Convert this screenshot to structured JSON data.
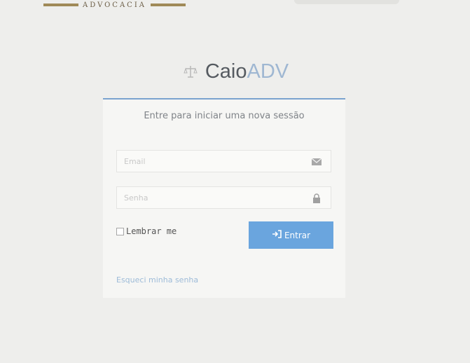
{
  "brand": {
    "tagline": "ADVOCACIA"
  },
  "logo": {
    "name_main": "Caio",
    "name_accent": "ADV",
    "icon": "scales-icon"
  },
  "login": {
    "title": "Entre para iniciar uma nova sessão",
    "email_placeholder": "Email",
    "email_icon": "envelope-icon",
    "password_placeholder": "Senha",
    "password_icon": "lock-icon",
    "remember_label": "Lembrar me",
    "submit_label": "Entrar",
    "submit_icon": "sign-in-icon",
    "forgot_link": "Esqueci minha senha"
  },
  "colors": {
    "accent": "#6aa5de",
    "card_border": "#7aa3cf",
    "brand_bar": "#a08a58",
    "link": "#9dbbd8"
  }
}
